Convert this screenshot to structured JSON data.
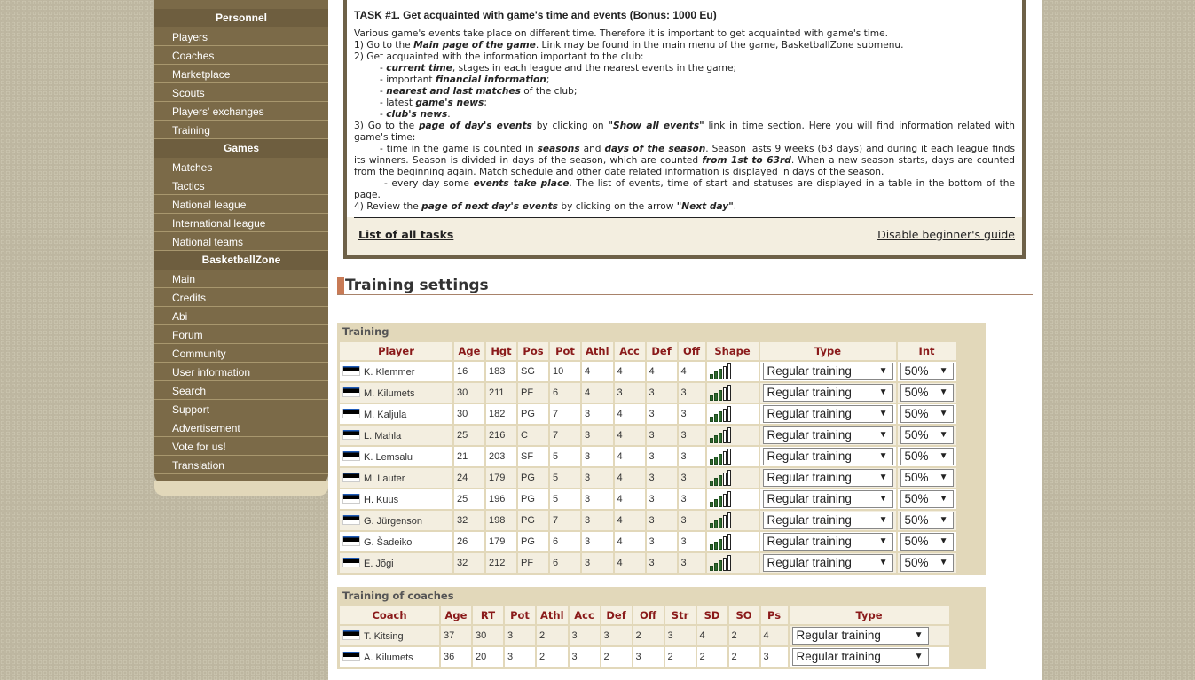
{
  "sidebar": {
    "sections": [
      {
        "title": "Personnel",
        "items": [
          "Players",
          "Coaches",
          "Marketplace",
          "Scouts",
          "Players' exchanges",
          "Training"
        ]
      },
      {
        "title": "Games",
        "items": [
          "Matches",
          "Tactics",
          "National league",
          "International league",
          "National teams"
        ]
      },
      {
        "title": "BasketballZone",
        "items": [
          "Main",
          "Credits",
          "Abi",
          "Forum",
          "Community",
          "User information",
          "Search",
          "Support",
          "Advertisement",
          "Vote for us!",
          "Translation"
        ]
      }
    ]
  },
  "guide": {
    "task_number": "TASK #1.",
    "task_title": "Get acquainted with game's time and events (Bonus: 1000 Eu)",
    "intro": "Various game's events take place on different time. Therefore it is important to get acquainted with game's time.",
    "step1_pre": "1) Go to the ",
    "step1_bold": "Main page of the game",
    "step1_post": ". Link may be found in the main menu of the game, BasketballZone submenu.",
    "step2": "2) Get acquainted with the information important to the club:",
    "step2_items": [
      {
        "pre": "- ",
        "bold": "current time",
        "post": ", stages in each league and the nearest events in the game;"
      },
      {
        "pre": "- important ",
        "bold": "financial information",
        "post": ";"
      },
      {
        "pre": "- ",
        "bold": "nearest and last matches",
        "post": " of the club;"
      },
      {
        "pre": "- latest ",
        "bold": "game's news",
        "post": ";"
      },
      {
        "pre": "- ",
        "bold": "club's news",
        "post": "."
      }
    ],
    "step3_pre": "3) Go to the ",
    "step3_bold": "page of day's events",
    "step3_mid": " by clicking on ",
    "step3_bold2": "\"Show all events\"",
    "step3_post": " link in time section. Here you will find information related with game's time:",
    "step3_a_pre": "- time in the game is counted in ",
    "step3_a_bold1": "seasons",
    "step3_a_mid1": " and ",
    "step3_a_bold2": "days of the season",
    "step3_a_mid2": ". Season lasts 9 weeks (63 days) and during it each league finds its winners. Season is divided in days of the season, which are counted ",
    "step3_a_bold3": "from 1st to 63rd",
    "step3_a_post": ". When a new season starts, days are counted from the beginning again. Match schedule and other date related information is displayed in days of the season.",
    "step3_b_pre": "- every day some ",
    "step3_b_bold": "events take place",
    "step3_b_post": ". The list of events, time of start and statuses are displayed in a table in the bottom of the page.",
    "step4_pre": "4) Review the ",
    "step4_bold": "page of next day's events",
    "step4_mid": " by clicking on the arrow ",
    "step4_bold2": "\"Next day\"",
    "step4_post": ".",
    "list_link": "List of all tasks",
    "disable_link": "Disable beginner's guide"
  },
  "page_title": "Training settings",
  "training": {
    "title": "Training",
    "columns": [
      "Player",
      "Age",
      "Hgt",
      "Pos",
      "Pot",
      "Athl",
      "Acc",
      "Def",
      "Off",
      "Shape",
      "Type",
      "Int"
    ],
    "rows": [
      {
        "player": "K. Klemmer",
        "age": "16",
        "hgt": "183",
        "pos": "SG",
        "pot": "10",
        "athl": "4",
        "acc": "4",
        "def": "4",
        "off": "4",
        "shape": 3,
        "type": "Regular training",
        "int": "50%"
      },
      {
        "player": "M. Kilumets",
        "age": "30",
        "hgt": "211",
        "pos": "PF",
        "pot": "6",
        "athl": "4",
        "acc": "3",
        "def": "3",
        "off": "3",
        "shape": 3,
        "type": "Regular training",
        "int": "50%"
      },
      {
        "player": "M. Kaljula",
        "age": "30",
        "hgt": "182",
        "pos": "PG",
        "pot": "7",
        "athl": "3",
        "acc": "4",
        "def": "3",
        "off": "3",
        "shape": 3,
        "type": "Regular training",
        "int": "50%"
      },
      {
        "player": "L. Mahla",
        "age": "25",
        "hgt": "216",
        "pos": "C",
        "pot": "7",
        "athl": "3",
        "acc": "4",
        "def": "3",
        "off": "3",
        "shape": 3,
        "type": "Regular training",
        "int": "50%"
      },
      {
        "player": "K. Lemsalu",
        "age": "21",
        "hgt": "203",
        "pos": "SF",
        "pot": "5",
        "athl": "3",
        "acc": "4",
        "def": "3",
        "off": "3",
        "shape": 3,
        "type": "Regular training",
        "int": "50%"
      },
      {
        "player": "M. Lauter",
        "age": "24",
        "hgt": "179",
        "pos": "PG",
        "pot": "5",
        "athl": "3",
        "acc": "4",
        "def": "3",
        "off": "3",
        "shape": 3,
        "type": "Regular training",
        "int": "50%"
      },
      {
        "player": "H. Kuus",
        "age": "25",
        "hgt": "196",
        "pos": "PG",
        "pot": "5",
        "athl": "3",
        "acc": "4",
        "def": "3",
        "off": "3",
        "shape": 3,
        "type": "Regular training",
        "int": "50%"
      },
      {
        "player": "G. Jürgenson",
        "age": "32",
        "hgt": "198",
        "pos": "PG",
        "pot": "7",
        "athl": "3",
        "acc": "4",
        "def": "3",
        "off": "3",
        "shape": 3,
        "type": "Regular training",
        "int": "50%"
      },
      {
        "player": "G. Šadeiko",
        "age": "26",
        "hgt": "179",
        "pos": "PG",
        "pot": "6",
        "athl": "3",
        "acc": "4",
        "def": "3",
        "off": "3",
        "shape": 3,
        "type": "Regular training",
        "int": "50%"
      },
      {
        "player": "E. Jõgi",
        "age": "32",
        "hgt": "212",
        "pos": "PF",
        "pot": "6",
        "athl": "3",
        "acc": "4",
        "def": "3",
        "off": "3",
        "shape": 3,
        "type": "Regular training",
        "int": "50%"
      }
    ],
    "shape_max": 5
  },
  "coaches": {
    "title": "Training of coaches",
    "columns": [
      "Coach",
      "Age",
      "RT",
      "Pot",
      "Athl",
      "Acc",
      "Def",
      "Off",
      "Str",
      "SD",
      "SO",
      "Ps",
      "Type"
    ],
    "rows": [
      {
        "coach": "T. Kitsing",
        "age": "37",
        "rt": "30",
        "pot": "3",
        "athl": "2",
        "acc": "3",
        "def": "3",
        "off": "2",
        "str": "3",
        "sd": "4",
        "so": "2",
        "ps": "4",
        "type": "Regular training"
      },
      {
        "coach": "A. Kilumets",
        "age": "36",
        "rt": "20",
        "pot": "3",
        "athl": "2",
        "acc": "3",
        "def": "2",
        "off": "3",
        "str": "2",
        "sd": "2",
        "so": "2",
        "ps": "3",
        "type": "Regular training"
      }
    ]
  },
  "icons": {
    "flag": "estonia-flag-icon",
    "shape": "shape-bars-icon",
    "dropdown": "▼"
  },
  "colors": {
    "sidebar_bg": "#7b6a48",
    "header_text": "#8a1a1a",
    "accent_bar": "#c87a55"
  }
}
